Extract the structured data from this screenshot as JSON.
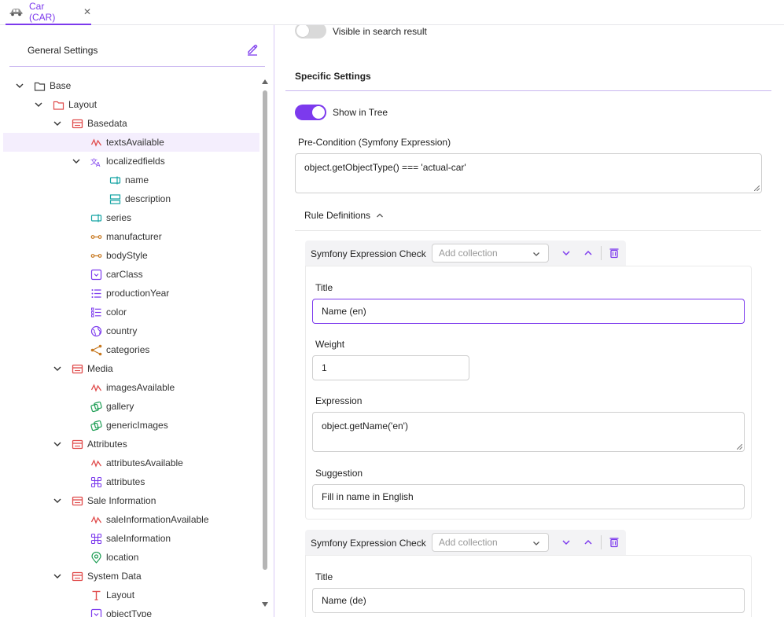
{
  "tab": {
    "label": "Car (CAR)",
    "close": "✕"
  },
  "left": {
    "title": "General Settings",
    "tree": [
      {
        "label": "Base",
        "icon": "folder-icon"
      },
      {
        "label": "Layout",
        "icon": "folder-red-icon"
      },
      {
        "label": "Basedata",
        "icon": "panel-icon"
      },
      {
        "label": "textsAvailable",
        "icon": "signal-icon"
      },
      {
        "label": "localizedfields",
        "icon": "translate-icon"
      },
      {
        "label": "name",
        "icon": "input-icon"
      },
      {
        "label": "description",
        "icon": "textarea-icon"
      },
      {
        "label": "series",
        "icon": "input-icon"
      },
      {
        "label": "manufacturer",
        "icon": "relation-icon"
      },
      {
        "label": "bodyStyle",
        "icon": "relation-icon"
      },
      {
        "label": "carClass",
        "icon": "select-icon"
      },
      {
        "label": "productionYear",
        "icon": "list-icon"
      },
      {
        "label": "color",
        "icon": "multiselect-icon"
      },
      {
        "label": "country",
        "icon": "globe-icon"
      },
      {
        "label": "categories",
        "icon": "share-icon"
      },
      {
        "label": "Media",
        "icon": "panel-icon"
      },
      {
        "label": "imagesAvailable",
        "icon": "signal-icon"
      },
      {
        "label": "gallery",
        "icon": "gallery-icon"
      },
      {
        "label": "genericImages",
        "icon": "gallery-icon"
      },
      {
        "label": "Attributes",
        "icon": "panel-icon"
      },
      {
        "label": "attributesAvailable",
        "icon": "signal-icon"
      },
      {
        "label": "attributes",
        "icon": "blocks-icon"
      },
      {
        "label": "Sale Information",
        "icon": "panel-icon"
      },
      {
        "label": "saleInformationAvailable",
        "icon": "signal-icon"
      },
      {
        "label": "saleInformation",
        "icon": "blocks-icon"
      },
      {
        "label": "location",
        "icon": "location-icon"
      },
      {
        "label": "System Data",
        "icon": "panel-icon"
      },
      {
        "label": "Layout",
        "icon": "text-icon"
      },
      {
        "label": "objectType",
        "icon": "select-icon"
      }
    ]
  },
  "right": {
    "visible_label": "Visible in search result",
    "specific_settings": "Specific Settings",
    "show_in_tree": "Show in Tree",
    "precondition_label": "Pre-Condition (Symfony Expression)",
    "precondition_value": "object.getObjectType() === 'actual-car'",
    "rule_definitions": "Rule Definitions",
    "rules": [
      {
        "type": "Symfony Expression Check",
        "collection_placeholder": "Add collection",
        "title_label": "Title",
        "title_value": "Name (en)",
        "weight_label": "Weight",
        "weight_value": "1",
        "expression_label": "Expression",
        "expression_value": "object.getName('en')",
        "suggestion_label": "Suggestion",
        "suggestion_value": "Fill in name in English"
      },
      {
        "type": "Symfony Expression Check",
        "collection_placeholder": "Add collection",
        "title_label": "Title",
        "title_value": "Name (de)"
      }
    ]
  },
  "colors": {
    "accent": "#7c3aed",
    "panel_red": "#e04b4b",
    "teal": "#14a3a3",
    "orange": "#c7781f",
    "purple": "#7c3aed",
    "green": "#1e9e55"
  }
}
